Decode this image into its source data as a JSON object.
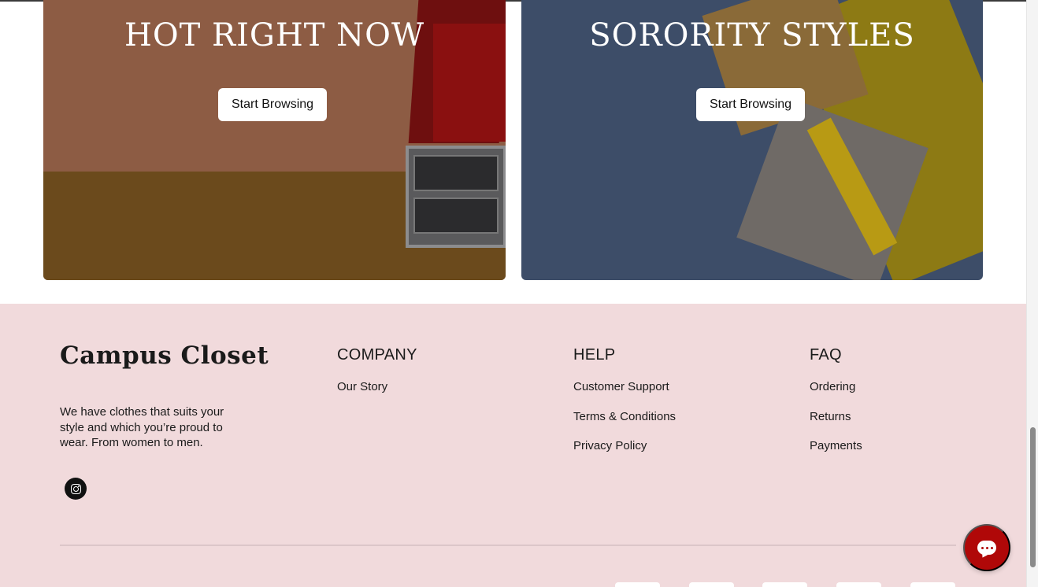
{
  "promos": [
    {
      "title": "HOT RIGHT NOW",
      "button_label": "Start Browsing"
    },
    {
      "title": "SORORITY STYLES",
      "button_label": "Start Browsing"
    }
  ],
  "footer": {
    "brand": "Campus Closet",
    "description": "We have clothes that suits your style and which you’re proud to wear. From women to men.",
    "social_icon": "instagram-icon",
    "columns": [
      {
        "title": "COMPANY",
        "links": [
          "Our Story"
        ]
      },
      {
        "title": "HELP",
        "links": [
          "Customer Support",
          "Terms & Conditions",
          "Privacy Policy"
        ]
      },
      {
        "title": "FAQ",
        "links": [
          "Ordering",
          "Returns",
          "Payments"
        ]
      }
    ]
  },
  "chat": {
    "icon": "chat-bubble-icon",
    "color": "#b00808"
  },
  "colors": {
    "footer_bg": "#f1dadc",
    "text": "#1a1a1a"
  }
}
